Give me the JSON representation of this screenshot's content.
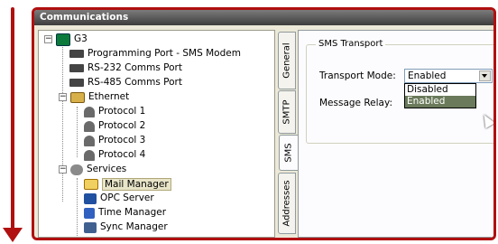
{
  "window": {
    "title": "Communications"
  },
  "tree": {
    "root": "G3",
    "items": [
      {
        "label": "Programming Port - SMS Modem"
      },
      {
        "label": "RS-232 Comms Port"
      },
      {
        "label": "RS-485 Comms Port"
      },
      {
        "label": "Ethernet"
      },
      {
        "label": "Protocol 1"
      },
      {
        "label": "Protocol 2"
      },
      {
        "label": "Protocol 3"
      },
      {
        "label": "Protocol 4"
      },
      {
        "label": "Services"
      },
      {
        "label": "Mail Manager"
      },
      {
        "label": "OPC Server"
      },
      {
        "label": "Time Manager"
      },
      {
        "label": "Sync Manager"
      }
    ]
  },
  "tabs": [
    "General",
    "SMTP",
    "SMS",
    "Addresses"
  ],
  "sms_transport": {
    "group_title": "SMS Transport",
    "transport_mode_label": "Transport Mode:",
    "transport_mode_value": "Enabled",
    "message_relay_label": "Message Relay:",
    "options": [
      "Disabled",
      "Enabled"
    ]
  },
  "colors": {
    "annotation": "#b01010",
    "title_bar": "#4a4a4a"
  }
}
